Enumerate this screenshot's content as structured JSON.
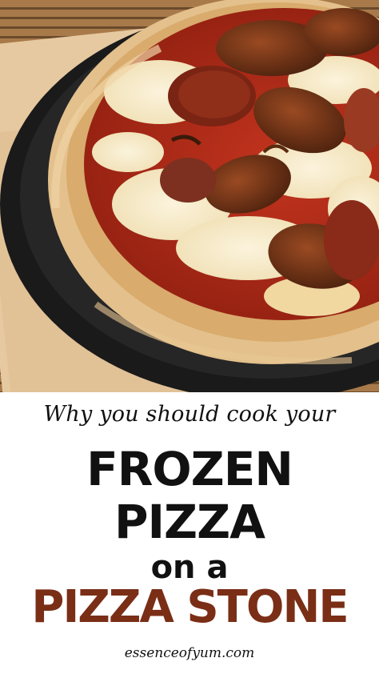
{
  "image": {
    "subject": "pizza-on-black-stone-photo"
  },
  "caption": {
    "tagline": "Why you should cook your",
    "line1": "FROZEN",
    "line2": "PIZZA",
    "line3": "on a",
    "line4": "PIZZA STONE",
    "site": "essenceofyum.com"
  },
  "colors": {
    "accent": "#7a2e16",
    "text": "#111111",
    "background": "#ffffff"
  }
}
